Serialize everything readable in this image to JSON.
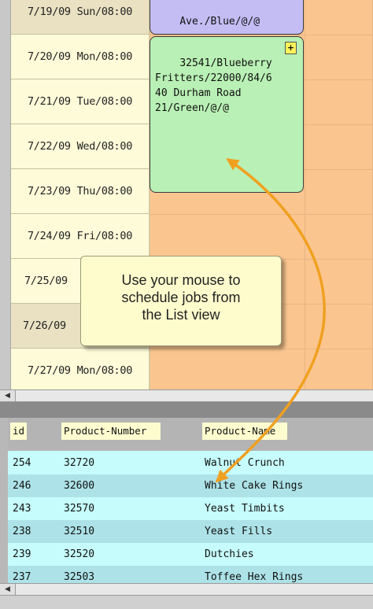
{
  "calendar": {
    "dates": [
      "7/19/09 Sun/08:00",
      "7/20/09 Mon/08:00",
      "7/21/09 Tue/08:00",
      "7/22/09 Wed/08:00",
      "7/23/09 Thu/08:00",
      "7/24/09 Fri/08:00",
      "7/25/09",
      "7/26/09",
      "7/27/09 Mon/08:00"
    ],
    "jobs": [
      {
        "text": "Ave./Blue/@/@",
        "color": "#c4bdf4"
      },
      {
        "text": "32541/Blueberry\nFritters/22000/84/6\n40 Durham Road\n21/Green/@/@",
        "color": "#b9f0b5",
        "button": "+"
      }
    ],
    "tooltip": "Use your mouse to\nschedule jobs from\nthe List view",
    "scroll_left_icon": "◀"
  },
  "list": {
    "columns": [
      "id",
      "Product-Number",
      "Product-Name"
    ],
    "rows": [
      {
        "id": "254",
        "number": "32720",
        "name": "Walnut Crunch"
      },
      {
        "id": "246",
        "number": "32600",
        "name": "White Cake Rings"
      },
      {
        "id": "243",
        "number": "32570",
        "name": "Yeast Timbits"
      },
      {
        "id": "238",
        "number": "32510",
        "name": "Yeast Fills"
      },
      {
        "id": "239",
        "number": "32520",
        "name": "Dutchies"
      },
      {
        "id": "237",
        "number": "32503",
        "name": "Toffee Hex Rings"
      }
    ],
    "scroll_left_icon": "◀"
  },
  "colors": {
    "calendar_bg": "#fbc58f",
    "date_plain": "#fefbd9",
    "date_shaded": "#e9e1c2",
    "list_row_light": "#c7fcfc",
    "list_row_dark": "#ade3e8",
    "arrow": "#f0a020"
  }
}
